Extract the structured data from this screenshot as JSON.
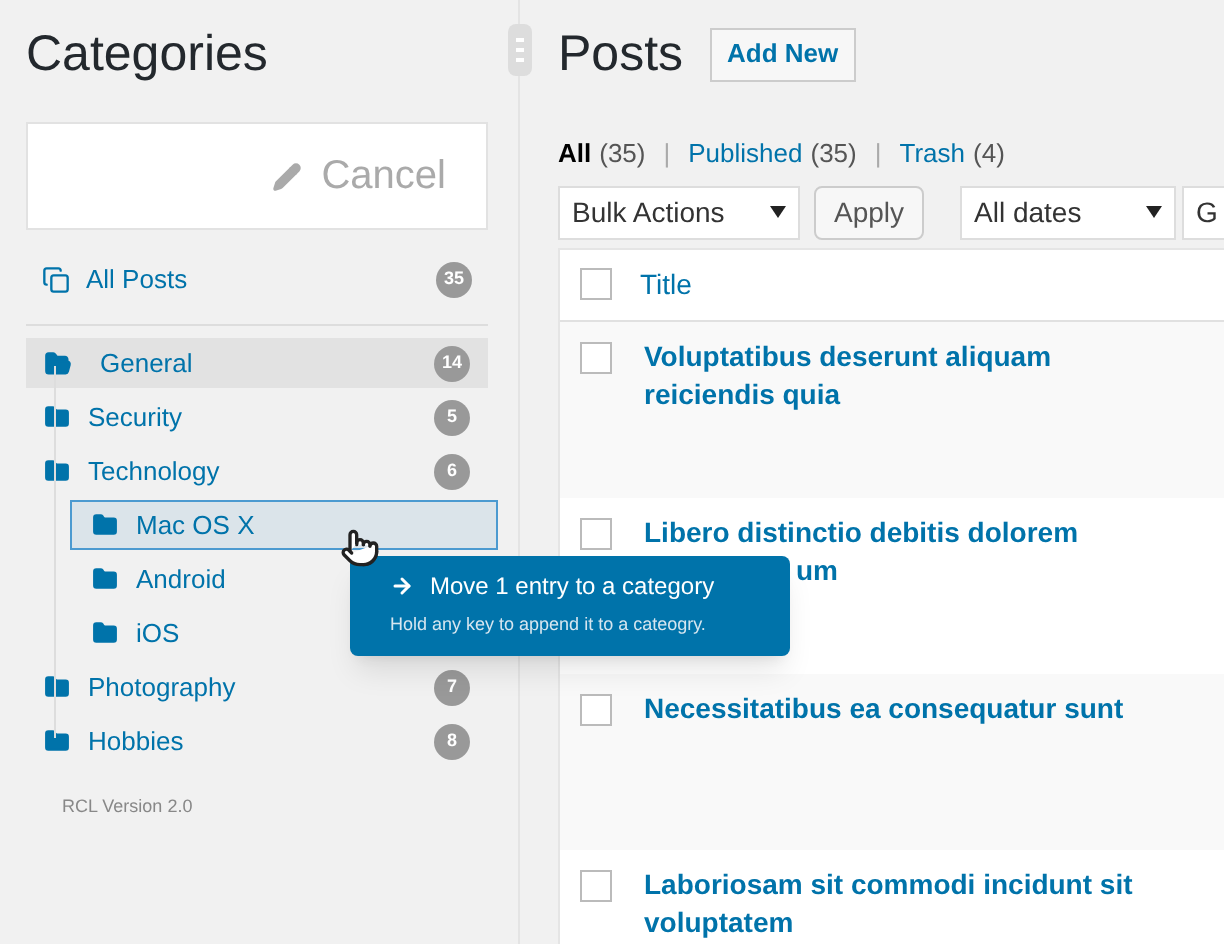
{
  "sidebar": {
    "title": "Categories",
    "cancel_button": "Cancel",
    "all_posts": {
      "label": "All Posts",
      "count": "35"
    },
    "categories": [
      {
        "name": "General",
        "count": "14",
        "selected": true,
        "drop_target": false
      },
      {
        "name": "Security",
        "count": "5",
        "selected": false,
        "drop_target": false
      },
      {
        "name": "Technology",
        "count": "6",
        "selected": false,
        "drop_target": false,
        "children": [
          {
            "name": "Mac OS X",
            "selected": false,
            "drop_target": true
          },
          {
            "name": "Android",
            "selected": false,
            "drop_target": false
          },
          {
            "name": "iOS",
            "selected": false,
            "drop_target": false
          }
        ]
      },
      {
        "name": "Photography",
        "count": "7",
        "selected": false,
        "drop_target": false
      },
      {
        "name": "Hobbies",
        "count": "8",
        "selected": false,
        "drop_target": false
      }
    ],
    "version": "RCL Version 2.0"
  },
  "tooltip": {
    "title": "Move 1 entry to a category",
    "hint": "Hold any key to append it to a cateogry."
  },
  "posts": {
    "title": "Posts",
    "add_new": "Add New",
    "filters": [
      {
        "label": "All",
        "count": "(35)",
        "selected": true
      },
      {
        "label": "Published",
        "count": "(35)",
        "selected": false
      },
      {
        "label": "Trash",
        "count": "(4)",
        "selected": false
      }
    ],
    "separator": "|",
    "bulk_actions": "Bulk Actions",
    "apply": "Apply",
    "dates": "All dates",
    "third_select": "G",
    "table": {
      "all_checked": false,
      "columns": [
        "Title"
      ],
      "rows": [
        {
          "title": "Voluptatibus deserunt aliquam reiciendis quia",
          "checked": false
        },
        {
          "title": "Libero distinctio debitis dolorem",
          "title_end": "um",
          "checked": false
        },
        {
          "title": "Necessitatibus ea consequatur sunt",
          "checked": false
        },
        {
          "title": "Laboriosam sit commodi incidunt sit voluptatem",
          "checked": false
        }
      ]
    }
  }
}
